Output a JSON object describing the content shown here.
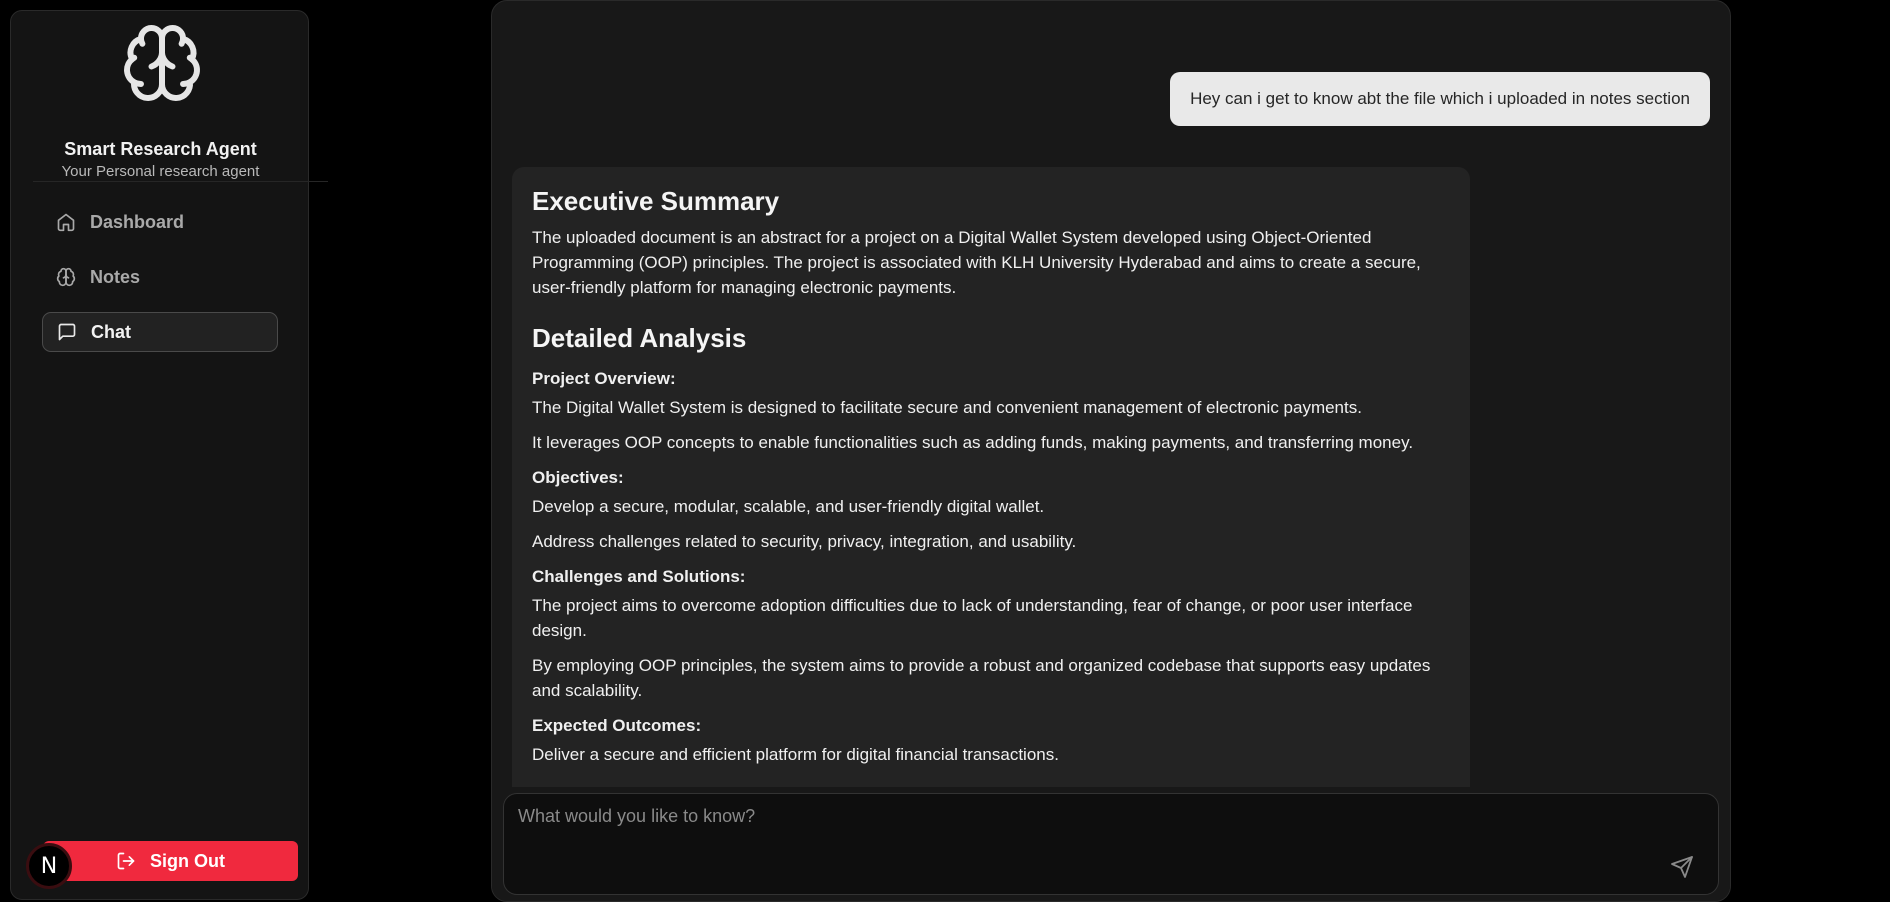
{
  "sidebar": {
    "brand_title": "Smart Research Agent",
    "brand_subtitle": "Your Personal research agent",
    "logo_icon": "brain-icon",
    "nav": [
      {
        "label": "Dashboard",
        "icon": "home-icon",
        "active": false
      },
      {
        "label": "Notes",
        "icon": "brain-icon",
        "active": false
      },
      {
        "label": "Chat",
        "icon": "message-square-icon",
        "active": true
      }
    ],
    "signout_label": "Sign Out",
    "avatar_initial": "N"
  },
  "chat": {
    "user_message": "Hey can i get to know abt the file which i uploaded in notes section",
    "response": {
      "heading1": "Executive Summary",
      "summary": "The uploaded document is an abstract for a project on a Digital Wallet System developed using Object-Oriented Programming (OOP) principles. The project is associated with KLH University Hyderabad and aims to create a secure, user-friendly platform for managing electronic payments.",
      "heading2": "Detailed Analysis",
      "sections": [
        {
          "title": "Project Overview:",
          "lines": [
            "The Digital Wallet System is designed to facilitate secure and convenient management of electronic payments.",
            "It leverages OOP concepts to enable functionalities such as adding funds, making payments, and transferring money."
          ]
        },
        {
          "title": "Objectives:",
          "lines": [
            "Develop a secure, modular, scalable, and user-friendly digital wallet.",
            "Address challenges related to security, privacy, integration, and usability."
          ]
        },
        {
          "title": "Challenges and Solutions:",
          "lines": [
            "The project aims to overcome adoption difficulties due to lack of understanding, fear of change, or poor user interface design.",
            "By employing OOP principles, the system aims to provide a robust and organized codebase that supports easy updates and scalability."
          ]
        },
        {
          "title": "Expected Outcomes:",
          "lines": [
            "Deliver a secure and efficient platform for digital financial transactions."
          ]
        }
      ]
    },
    "input_placeholder": "What would you like to know?",
    "send_icon": "send-icon"
  },
  "colors": {
    "accent_signout": "#f0293e",
    "background": "#000000",
    "panel": "#181818"
  }
}
